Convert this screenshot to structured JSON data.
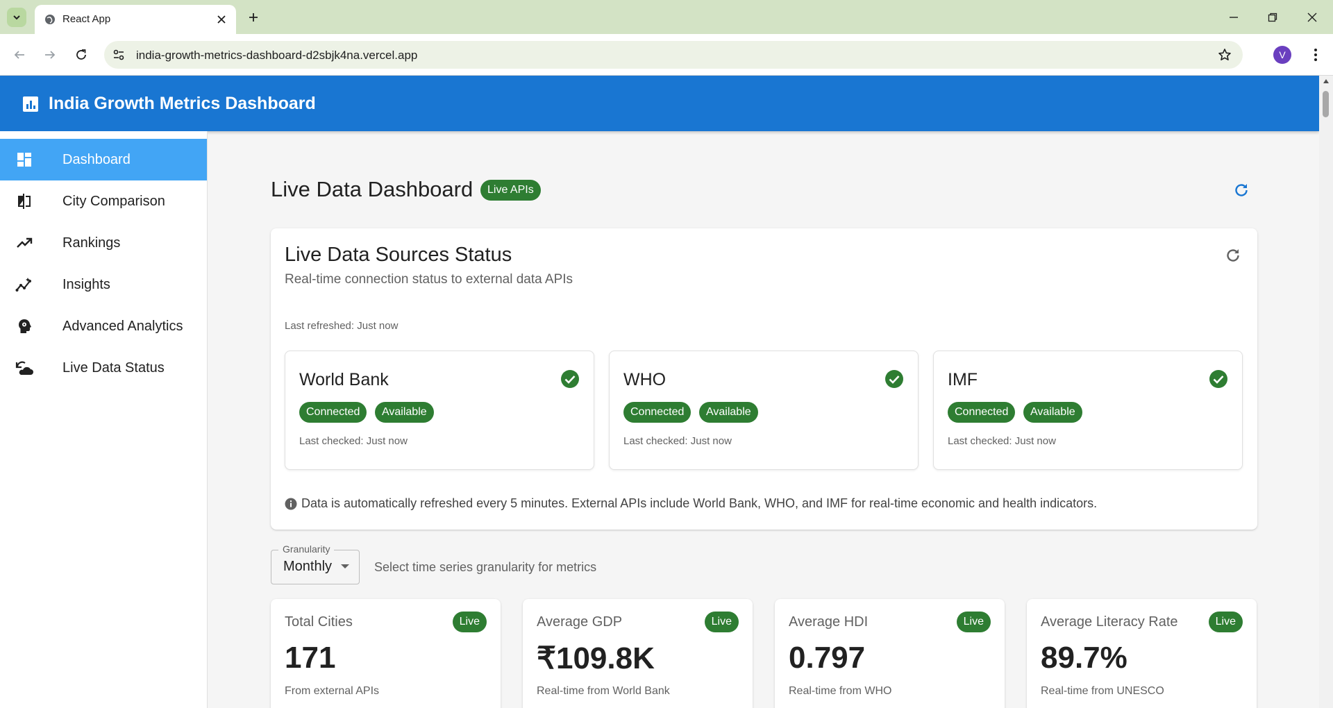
{
  "browser": {
    "tab_title": "React App",
    "url": "india-growth-metrics-dashboard-d2sbjk4na.vercel.app",
    "profile_initial": "V"
  },
  "app": {
    "title": "India Growth Metrics Dashboard"
  },
  "sidebar": {
    "items": [
      {
        "label": "Dashboard",
        "icon": "dashboard-icon",
        "active": true
      },
      {
        "label": "City Comparison",
        "icon": "compare-icon",
        "active": false
      },
      {
        "label": "Rankings",
        "icon": "trending-up-icon",
        "active": false
      },
      {
        "label": "Insights",
        "icon": "insights-icon",
        "active": false
      },
      {
        "label": "Advanced Analytics",
        "icon": "psychology-icon",
        "active": false
      },
      {
        "label": "Live Data Status",
        "icon": "cloud-sync-icon",
        "active": false
      }
    ]
  },
  "page": {
    "title": "Live Data Dashboard",
    "badge": "Live APIs"
  },
  "status_panel": {
    "title": "Live Data Sources Status",
    "subtitle": "Real-time connection status to external data APIs",
    "last_refreshed": "Last refreshed: Just now",
    "sources": [
      {
        "name": "World Bank",
        "status": "Connected",
        "availability": "Available",
        "last_checked": "Last checked: Just now"
      },
      {
        "name": "WHO",
        "status": "Connected",
        "availability": "Available",
        "last_checked": "Last checked: Just now"
      },
      {
        "name": "IMF",
        "status": "Connected",
        "availability": "Available",
        "last_checked": "Last checked: Just now"
      }
    ],
    "info": "Data is automatically refreshed every 5 minutes. External APIs include World Bank, WHO, and IMF for real-time economic and health indicators."
  },
  "granularity": {
    "label": "Granularity",
    "value": "Monthly",
    "help": "Select time series granularity for metrics"
  },
  "metrics": [
    {
      "title": "Total Cities",
      "badge": "Live",
      "value": "171",
      "sub": "From external APIs"
    },
    {
      "title": "Average GDP",
      "badge": "Live",
      "value": "₹109.8K",
      "sub": "Real-time from World Bank"
    },
    {
      "title": "Average HDI",
      "badge": "Live",
      "value": "0.797",
      "sub": "Real-time from WHO"
    },
    {
      "title": "Average Literacy Rate",
      "badge": "Live",
      "value": "89.7%",
      "sub": "Real-time from UNESCO"
    }
  ],
  "colors": {
    "primary": "#1976d2",
    "active_nav": "#42a5f5",
    "success": "#2e7d32",
    "background": "#f5f5f5"
  }
}
